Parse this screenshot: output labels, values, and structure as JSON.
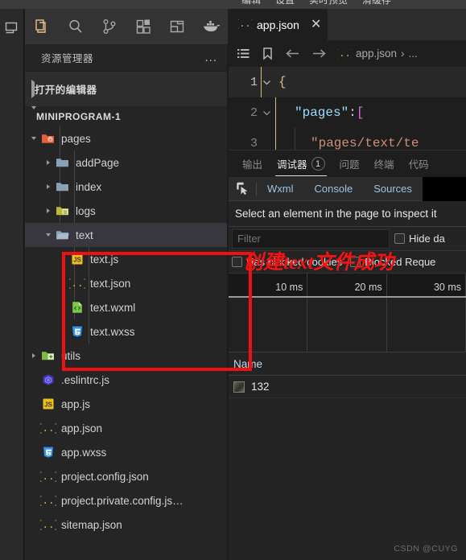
{
  "menubar": {
    "items": [
      "编辑",
      "设置",
      "实时预览",
      "清缓存"
    ]
  },
  "activity_bar": {
    "strip_icon": "simulator-screen-icon",
    "items": [
      {
        "name": "explorer-icon",
        "label": "资源管理器",
        "active": true
      },
      {
        "name": "search-icon",
        "label": "搜索"
      },
      {
        "name": "source-control-icon",
        "label": "源代码管理"
      },
      {
        "name": "extensions-icon",
        "label": "扩展"
      },
      {
        "name": "layout-split-icon",
        "label": "布局"
      },
      {
        "name": "docker-whale-icon",
        "label": "Docker"
      }
    ]
  },
  "sidebar": {
    "title": "资源管理器",
    "more_label": "...",
    "open_editors_label": "打开的编辑器",
    "project_label": "MINIPROGRAM-1",
    "tree": [
      {
        "label": "pages",
        "icon": "folder-open-pages-icon",
        "type": "folder",
        "depth": 1,
        "expanded": true,
        "selected": false
      },
      {
        "label": "addPage",
        "icon": "folder-icon",
        "type": "folder",
        "depth": 2,
        "expanded": false,
        "selected": false
      },
      {
        "label": "index",
        "icon": "folder-icon",
        "type": "folder",
        "depth": 2,
        "expanded": false,
        "selected": false
      },
      {
        "label": "logs",
        "icon": "folder-logs-icon",
        "type": "folder",
        "depth": 2,
        "expanded": false,
        "selected": false
      },
      {
        "label": "text",
        "icon": "folder-open-icon",
        "type": "folder",
        "depth": 2,
        "expanded": true,
        "selected": true
      },
      {
        "label": "text.js",
        "icon": "js-file-icon",
        "type": "file",
        "depth": 3,
        "selected": false
      },
      {
        "label": "text.json",
        "icon": "json-file-icon",
        "type": "file",
        "depth": 3,
        "selected": false
      },
      {
        "label": "text.wxml",
        "icon": "wxml-file-icon",
        "type": "file",
        "depth": 3,
        "selected": false
      },
      {
        "label": "text.wxss",
        "icon": "wxss-file-icon",
        "type": "file",
        "depth": 3,
        "selected": false
      },
      {
        "label": "utils",
        "icon": "folder-utils-icon",
        "type": "folder",
        "depth": 1,
        "expanded": false,
        "selected": false
      },
      {
        "label": ".eslintrc.js",
        "icon": "eslint-file-icon",
        "type": "file",
        "depth": 1,
        "selected": false
      },
      {
        "label": "app.js",
        "icon": "js-file-icon",
        "type": "file",
        "depth": 1,
        "selected": false
      },
      {
        "label": "app.json",
        "icon": "json-file-icon",
        "type": "file",
        "depth": 1,
        "selected": false
      },
      {
        "label": "app.wxss",
        "icon": "wxss-file-icon",
        "type": "file",
        "depth": 1,
        "selected": false
      },
      {
        "label": "project.config.json",
        "icon": "json-file-icon",
        "type": "file",
        "depth": 1,
        "selected": false
      },
      {
        "label": "project.private.config.js…",
        "icon": "json-file-icon",
        "type": "file",
        "depth": 1,
        "selected": false
      },
      {
        "label": "sitemap.json",
        "icon": "json-file-icon",
        "type": "file",
        "depth": 1,
        "selected": false
      }
    ]
  },
  "editor": {
    "tab": {
      "label": "app.json",
      "icon": "json-file-icon",
      "close": "✕"
    },
    "breadcrumb": {
      "outline_icon": "list-outline-icon",
      "bookmark_icon": "bookmark-icon",
      "back_icon": "arrow-left-icon",
      "forward_icon": "arrow-right-icon",
      "file_icon": "json-file-icon",
      "file": "app.json",
      "separator": "›",
      "tail": "..."
    },
    "lines": [
      {
        "num": "1",
        "current": true,
        "foldable": true,
        "text": "{"
      },
      {
        "num": "2",
        "current": false,
        "foldable": true,
        "text": "\"pages\":["
      },
      {
        "num": "3",
        "current": false,
        "foldable": false,
        "text": "\"pages/text/te"
      }
    ]
  },
  "panel": {
    "tabs": [
      {
        "label": "输出",
        "active": false,
        "badge": null
      },
      {
        "label": "调试器",
        "active": true,
        "badge": "1"
      },
      {
        "label": "问题",
        "active": false,
        "badge": null
      },
      {
        "label": "终端",
        "active": false,
        "badge": null
      },
      {
        "label": "代码",
        "active": false,
        "badge": null
      }
    ],
    "devtools": {
      "inspect_icon": "inspect-element-icon",
      "tabs": [
        "Wxml",
        "Console",
        "Sources"
      ],
      "hint": "Select an element in the page to inspect it",
      "filter_placeholder": "Filter",
      "filter_value": "",
      "checkboxes": [
        {
          "label": "Hide da",
          "checked": false
        },
        {
          "label": "Has blocked cookies",
          "checked": false
        },
        {
          "label": "Blocked Reque",
          "checked": false
        }
      ],
      "timeline_ticks": [
        "10 ms",
        "20 ms",
        "30 ms"
      ],
      "table": {
        "headers": [
          "Name"
        ],
        "rows": [
          {
            "icon": "thumbnail-icon",
            "name": "132"
          }
        ]
      }
    }
  },
  "annotation": {
    "text": "创建text文件成功",
    "color": "#f01414"
  },
  "watermark": "CSDN @CUYG",
  "colors": {
    "accent_red": "#ee1111",
    "selected_row": "#37373d",
    "sidebar_bg": "#252526",
    "editor_bg": "#1e1e1e",
    "devtools_link": "#9cc4e4"
  }
}
